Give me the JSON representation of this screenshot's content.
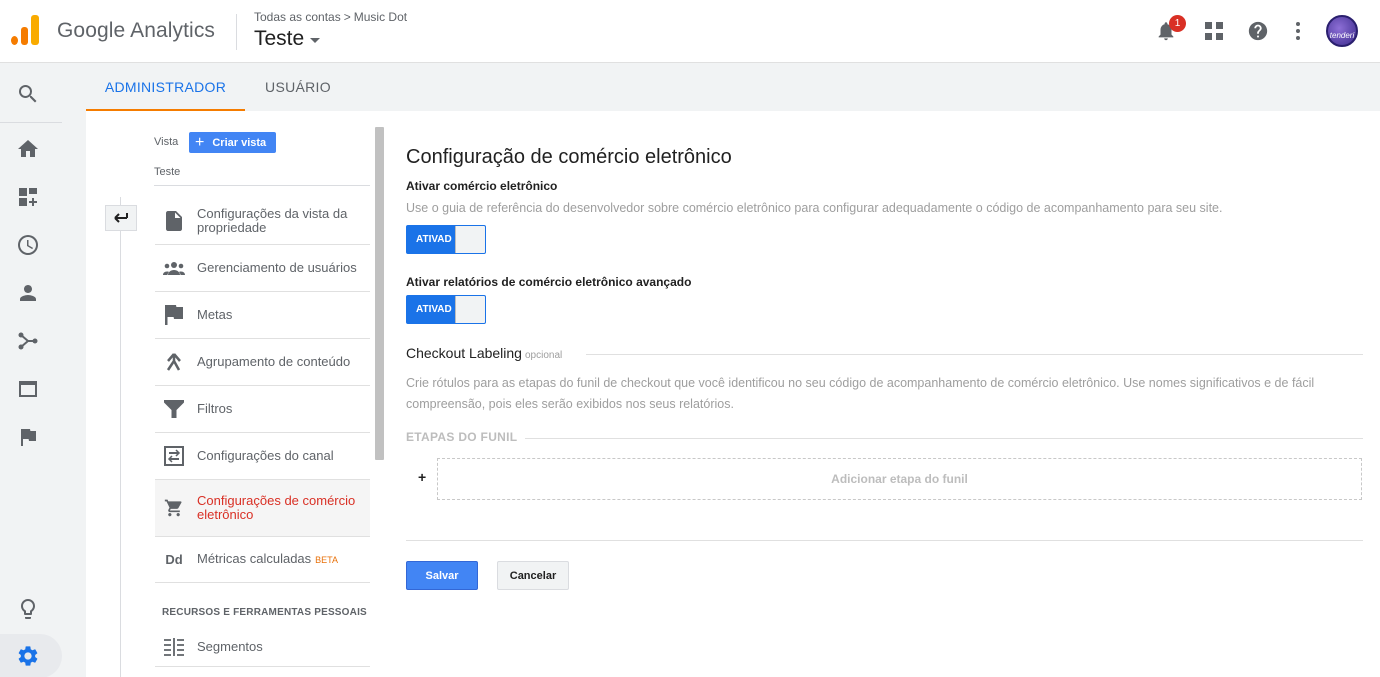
{
  "app": {
    "brand": "Google Analytics",
    "breadcrumb": {
      "account": "Todas as contas",
      "property": "Music Dot"
    },
    "view_name": "Teste",
    "notifications_count": "1",
    "avatar_text": "tenderi",
    "colors": {
      "accent": "#1a73e8",
      "tab_underline": "#f57c00",
      "active_menu": "#d93025"
    }
  },
  "topbar_icons": [
    "notifications-icon",
    "apps-icon",
    "help-icon",
    "more-vert-icon",
    "avatar"
  ],
  "leftnav": [
    "search-icon",
    "home-icon",
    "customization-icon",
    "realtime-icon",
    "audience-icon",
    "acquisition-icon",
    "behavior-icon",
    "conversions-icon",
    "discover-icon",
    "admin-gear-icon"
  ],
  "tabs": [
    {
      "label": "ADMINISTRADOR",
      "active": true
    },
    {
      "label": "USUÁRIO",
      "active": false
    }
  ],
  "view_column": {
    "label": "Vista",
    "create_button": "Criar vista",
    "current_view": "Teste",
    "menu": [
      {
        "label": "Configurações da vista da propriedade",
        "icon": "document-icon"
      },
      {
        "label": "Gerenciamento de usuários",
        "icon": "people-icon"
      },
      {
        "label": "Metas",
        "icon": "flag-icon"
      },
      {
        "label": "Agrupamento de conteúdo",
        "icon": "content-grouping-icon"
      },
      {
        "label": "Filtros",
        "icon": "filter-icon"
      },
      {
        "label": "Configurações do canal",
        "icon": "channel-settings-icon"
      },
      {
        "label": "Configurações de comércio eletrônico",
        "icon": "cart-icon",
        "active": true
      },
      {
        "label": "Métricas calculadas",
        "icon": "dd-icon",
        "badge": "BETA"
      },
      {
        "label": "Segmentos",
        "icon": "segments-icon"
      }
    ],
    "section_title": "RECURSOS E FERRAMENTAS PESSOAIS"
  },
  "form": {
    "title": "Configuração de comércio eletrônico",
    "enable_ecommerce": {
      "label": "Ativar comércio eletrônico",
      "help": "Use o guia de referência do desenvolvedor sobre comércio eletrônico para configurar adequadamente o código de acompanhamento para seu site.",
      "toggle_text": "ATIVAD"
    },
    "enable_enhanced": {
      "label": "Ativar relatórios de comércio eletrônico avançado",
      "toggle_text": "ATIVAD"
    },
    "checkout": {
      "title": "Checkout Labeling",
      "optional": "opcional",
      "help_line1": "Crie rótulos para as etapas do funil de checkout que você identificou no seu código de acompanhamento de comércio eletrônico. Use nomes significativos e de fácil",
      "help_line2": "compreensão, pois eles serão exibidos nos seus relatórios.",
      "funnel_label": "ETAPAS DO FUNIL",
      "add_plus": "+",
      "add_step": "Adicionar etapa do funil"
    },
    "save": "Salvar",
    "cancel": "Cancelar"
  }
}
